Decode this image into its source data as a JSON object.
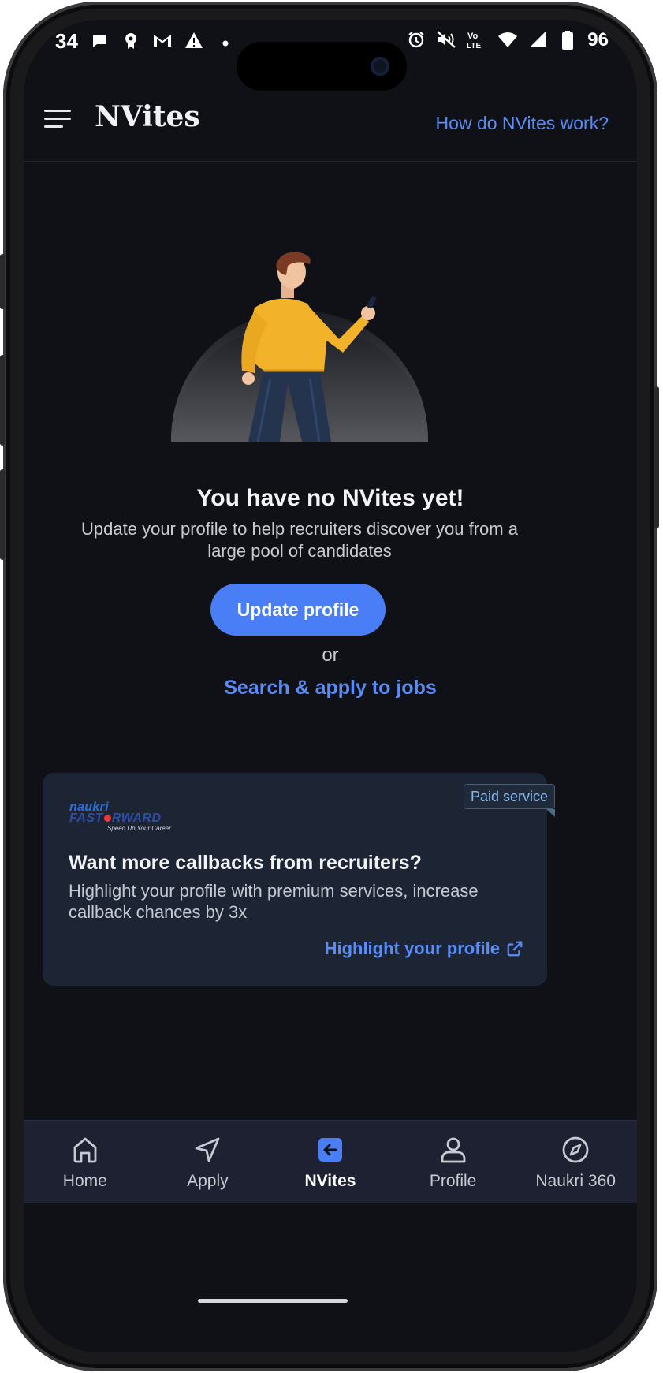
{
  "status_bar": {
    "time": "34",
    "battery": "96"
  },
  "header": {
    "title": "NVites",
    "help_link": "How do NVites work?"
  },
  "empty_state": {
    "title": "You have no NVites yet!",
    "subtitle": "Update your profile to help recruiters discover you from a large pool of candidates",
    "primary_button": "Update profile",
    "or_text": "or",
    "secondary_link": "Search & apply to jobs"
  },
  "promo": {
    "badge": "Paid service",
    "logo_naukri": "naukri",
    "logo_ff_left": "FAST",
    "logo_ff_right": "RWARD",
    "logo_tagline": "Speed Up Your Career",
    "title": "Want more callbacks from recruiters?",
    "description": "Highlight your profile with premium services, increase callback chances by 3x",
    "link": "Highlight your profile"
  },
  "bottom_nav": {
    "items": [
      {
        "label": "Home",
        "icon": "home-icon"
      },
      {
        "label": "Apply",
        "icon": "send-icon"
      },
      {
        "label": "NVites",
        "icon": "nvites-icon",
        "active": true
      },
      {
        "label": "Profile",
        "icon": "person-icon"
      },
      {
        "label": "Naukri 360",
        "icon": "compass-icon"
      }
    ]
  },
  "colors": {
    "background": "#101116",
    "accent": "#4a7ef6",
    "link": "#5b8cf5",
    "card": "#1d2535",
    "nav": "#1d2131"
  }
}
